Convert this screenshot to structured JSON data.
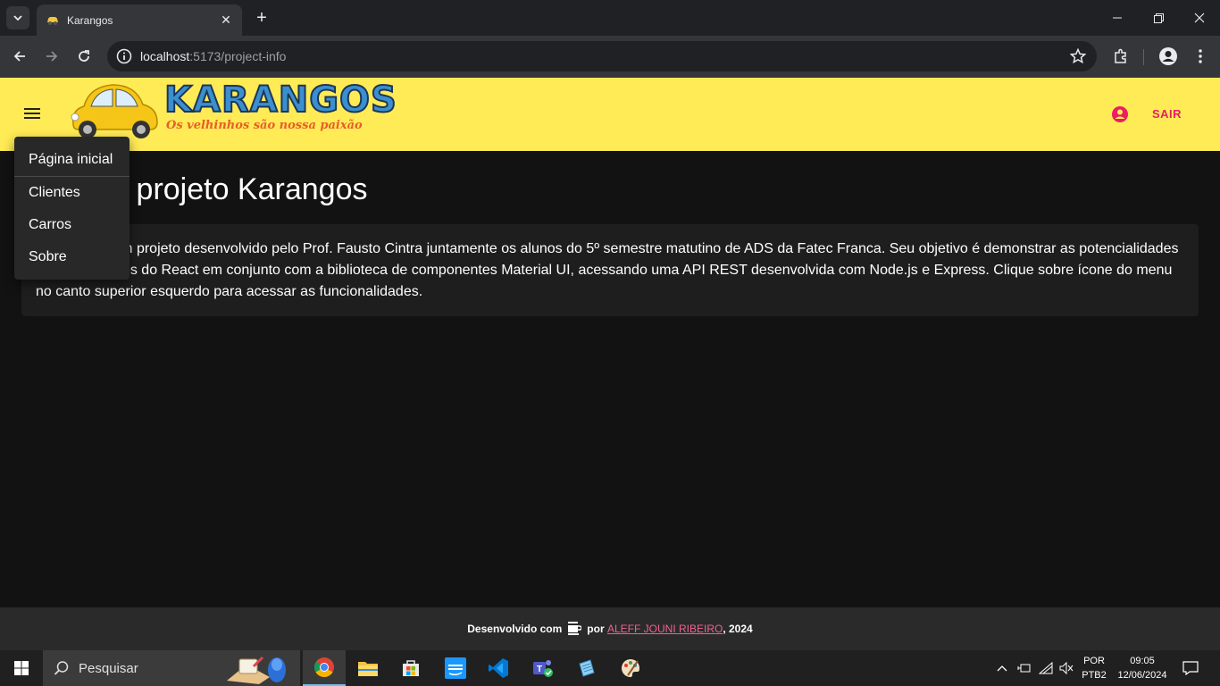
{
  "browser": {
    "tab_title": "Karangos",
    "url_host": "localhost",
    "url_path": ":5173/project-info"
  },
  "app": {
    "logo_text": "KARANGOS",
    "logo_tagline": "Os velhinhos são nossa paixão",
    "logout_label": "SAIR",
    "accent_color": "#e91e63",
    "header_color": "#ffeb55"
  },
  "page": {
    "title": "Sobre o projeto Karangos",
    "description": "Karangos é um projeto desenvolvido pelo Prof. Fausto Cintra juntamente os alunos do 5º semestre matutino de ADS da Fatec Franca. Seu objetivo é demonstrar as potencialidades e possibilidades do React em conjunto com a biblioteca de componentes Material UI, acessando uma API REST desenvolvida com Node.js e Express. Clique sobre ícone do menu no canto superior esquerdo para acessar as funcionalidades."
  },
  "menu": {
    "items": [
      {
        "label": "Página inicial"
      },
      {
        "label": "Clientes"
      },
      {
        "label": "Carros"
      },
      {
        "label": "Sobre"
      }
    ]
  },
  "footer": {
    "prefix": "Desenvolvido com",
    "by": "por",
    "author": "ALEFF JOUNI RIBEIRO",
    "year": ", 2024"
  },
  "taskbar": {
    "search_placeholder": "Pesquisar",
    "lang_line1": "POR",
    "lang_line2": "PTB2",
    "time": "09:05",
    "date": "12/06/2024"
  }
}
